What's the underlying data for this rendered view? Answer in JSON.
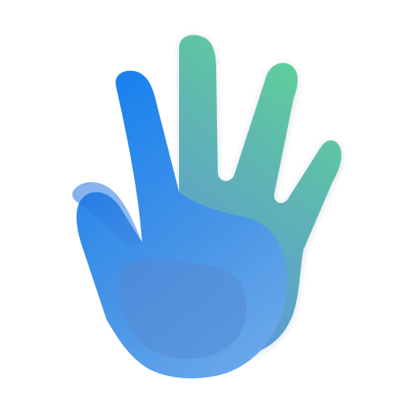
{
  "icon": {
    "name": "hand-icon",
    "colors": {
      "back_hand_top": "#5fd09a",
      "back_hand_bottom": "#5a98d6",
      "front_hand_top": "#1c83ee",
      "front_hand_bottom": "#6aa8ea",
      "palm_shade": "#4e8ad9",
      "background": "#ffffff"
    }
  }
}
